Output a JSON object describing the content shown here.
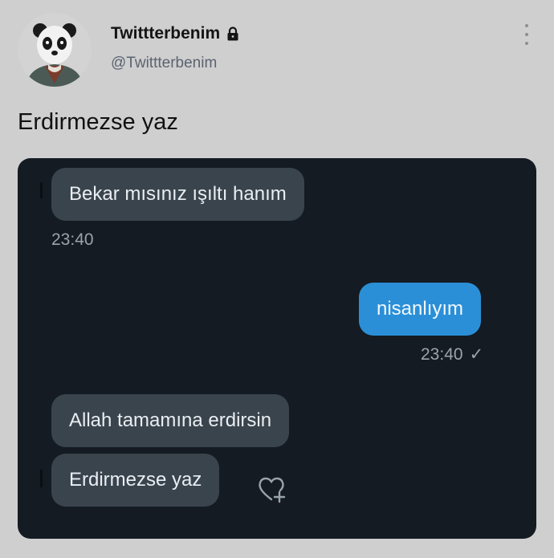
{
  "author": {
    "name": "Twittterbenim",
    "handle": "@Twittterbenim"
  },
  "tweet": {
    "text": "Erdirmezse yaz"
  },
  "chat": {
    "messages": [
      {
        "side": "incoming",
        "text": "Bekar mısınız ışıltı hanım"
      },
      {
        "side": "outgoing",
        "text": "nisanlıyım"
      },
      {
        "side": "incoming",
        "text": "Allah tamamına erdirsin"
      },
      {
        "side": "incoming",
        "text": "Erdirmezse yaz"
      }
    ],
    "time_incoming": "23:40",
    "time_outgoing": "23:40",
    "read_check": "✓"
  },
  "icons": {
    "avatar": "panda-avatar",
    "lock": "lock-icon",
    "more": "more-vertical-icon",
    "react": "heart-add-icon"
  },
  "colors": {
    "background": "#cfcfcf",
    "media_bg": "#141b22",
    "incoming_bubble": "#3a444d",
    "outgoing_bubble": "#2b8fd7"
  }
}
